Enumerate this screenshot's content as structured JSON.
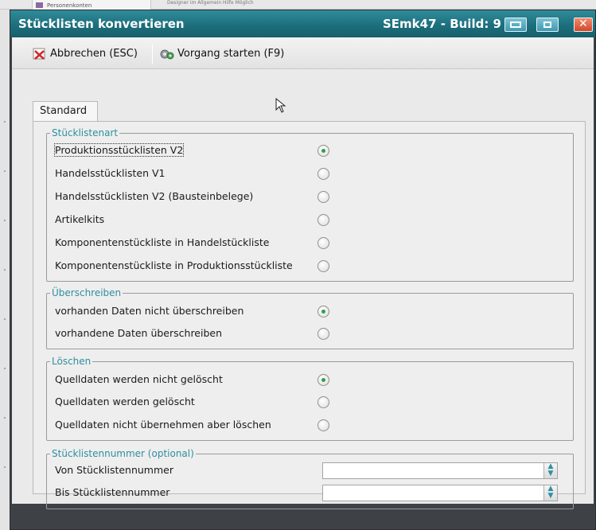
{
  "background_app": {
    "item_label": "Personenkonten",
    "small_text": "Designer im Allgemein Hilfe Möglich"
  },
  "window": {
    "title": "Stücklisten konvertieren",
    "build": "SEmk47 - Build: 9"
  },
  "toolbar": {
    "cancel_label": "Abbrechen (ESC)",
    "start_label": "Vorgang starten (F9)"
  },
  "tab": {
    "label": "Standard"
  },
  "groups": {
    "stuecklistenart": {
      "legend": "Stücklistenart",
      "options": [
        {
          "label": "Produktionsstücklisten V2",
          "selected": true
        },
        {
          "label": "Handelsstücklisten V1",
          "selected": false
        },
        {
          "label": "Handelsstücklisten V2 (Bausteinbelege)",
          "selected": false
        },
        {
          "label": "Artikelkits",
          "selected": false
        },
        {
          "label": "Komponentenstückliste in Handelstückliste",
          "selected": false
        },
        {
          "label": "Komponentenstückliste in Produktionsstückliste",
          "selected": false
        }
      ]
    },
    "ueberschreiben": {
      "legend": "Überschreiben",
      "options": [
        {
          "label": "vorhanden Daten nicht überschreiben",
          "selected": true
        },
        {
          "label": "vorhandene Daten überschreiben",
          "selected": false
        }
      ]
    },
    "loeschen": {
      "legend": "Löschen",
      "options": [
        {
          "label": "Quelldaten werden nicht gelöscht",
          "selected": true
        },
        {
          "label": "Quelldaten werden gelöscht",
          "selected": false
        },
        {
          "label": "Quelldaten nicht übernehmen aber löschen",
          "selected": false
        }
      ]
    },
    "nummer": {
      "legend": "Stücklistennummer (optional)",
      "fields": [
        {
          "label": "Von Stücklistennummer",
          "value": ""
        },
        {
          "label": "Bis Stücklistennummer",
          "value": ""
        }
      ]
    }
  },
  "colors": {
    "titlebar": "#1d6f7d",
    "legend": "#2f8fa0",
    "radio_selected": "#2fa04a",
    "cancel_icon": "#d32a2a"
  },
  "icons": {
    "cancel": "cancel-x-icon",
    "start": "gears-icon",
    "spin": "spin-updown-icon"
  }
}
